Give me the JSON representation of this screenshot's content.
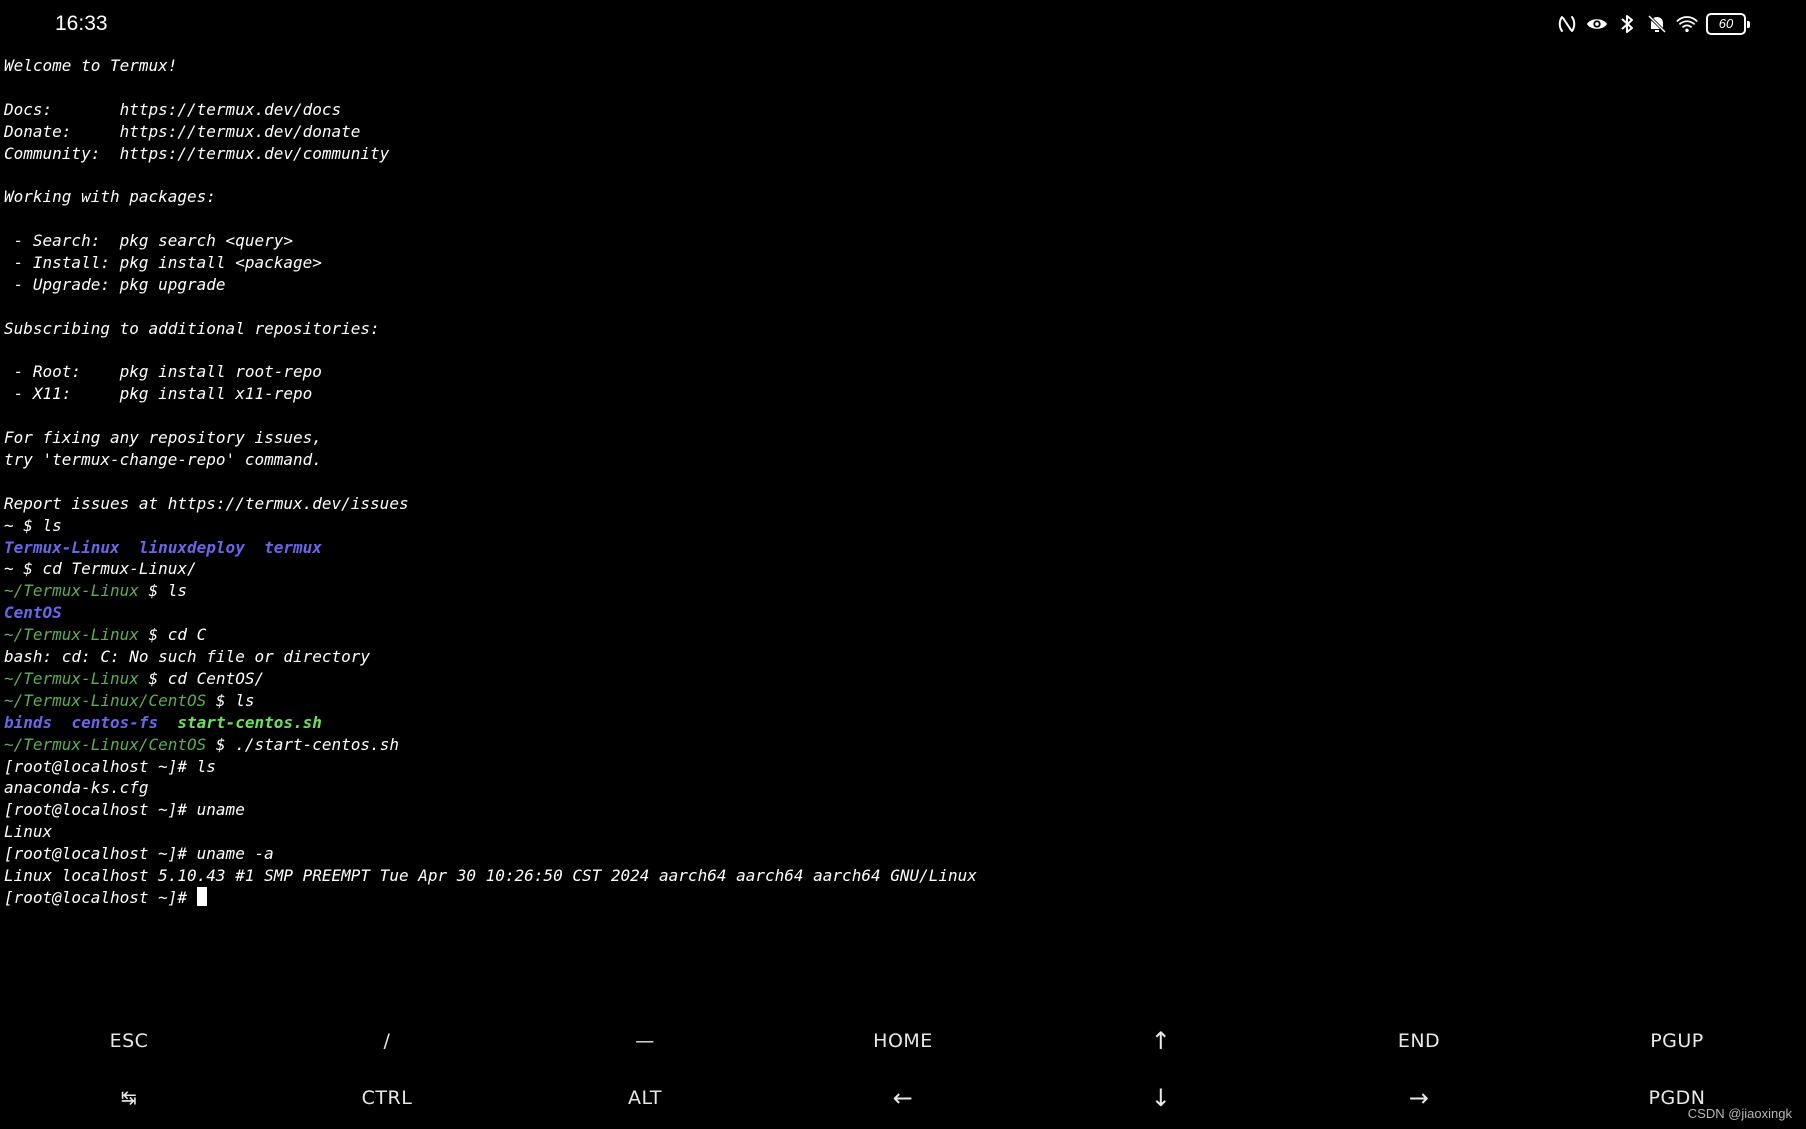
{
  "status_bar": {
    "time": "16:33",
    "battery_level": "60",
    "icons": [
      "nfc-icon",
      "eye-icon",
      "bluetooth-icon",
      "mute-bell-icon",
      "wifi-icon",
      "battery-icon"
    ]
  },
  "terminal": {
    "lines": [
      [
        {
          "t": "Welcome to Termux!"
        }
      ],
      [],
      [
        {
          "t": "Docs:       https://termux.dev/docs"
        }
      ],
      [
        {
          "t": "Donate:     https://termux.dev/donate"
        }
      ],
      [
        {
          "t": "Community:  https://termux.dev/community"
        }
      ],
      [],
      [
        {
          "t": "Working with packages:"
        }
      ],
      [],
      [
        {
          "t": " - Search:  pkg search <query>"
        }
      ],
      [
        {
          "t": " - Install: pkg install <package>"
        }
      ],
      [
        {
          "t": " - Upgrade: pkg upgrade"
        }
      ],
      [],
      [
        {
          "t": "Subscribing to additional repositories:"
        }
      ],
      [],
      [
        {
          "t": " - Root:    pkg install root-repo"
        }
      ],
      [
        {
          "t": " - X11:     pkg install x11-repo"
        }
      ],
      [],
      [
        {
          "t": "For fixing any repository issues,"
        }
      ],
      [
        {
          "t": "try 'termux-change-repo' command."
        }
      ],
      [],
      [
        {
          "t": "Report issues at https://termux.dev/issues"
        }
      ],
      [
        {
          "t": "~ $ ls"
        }
      ],
      [
        {
          "t": "Termux-Linux",
          "c": "blue"
        },
        {
          "t": "  "
        },
        {
          "t": "linuxdeploy",
          "c": "blue"
        },
        {
          "t": "  "
        },
        {
          "t": "termux",
          "c": "blue"
        }
      ],
      [
        {
          "t": "~ $ cd Termux-Linux/"
        }
      ],
      [
        {
          "t": "~/Termux-Linux",
          "c": "green"
        },
        {
          "t": " $ ls"
        }
      ],
      [
        {
          "t": "CentOS",
          "c": "blue"
        }
      ],
      [
        {
          "t": "~/Termux-Linux",
          "c": "green"
        },
        {
          "t": " $ cd C"
        }
      ],
      [
        {
          "t": "bash: cd: C: No such file or directory"
        }
      ],
      [
        {
          "t": "~/Termux-Linux",
          "c": "green"
        },
        {
          "t": " $ cd CentOS/"
        }
      ],
      [
        {
          "t": "~/Termux-Linux/CentOS",
          "c": "green"
        },
        {
          "t": " $ ls"
        }
      ],
      [
        {
          "t": "binds",
          "c": "blue"
        },
        {
          "t": "  "
        },
        {
          "t": "centos-fs",
          "c": "blue"
        },
        {
          "t": "  "
        },
        {
          "t": "start-centos.sh",
          "c": "bgreen"
        }
      ],
      [
        {
          "t": "~/Termux-Linux/CentOS",
          "c": "green"
        },
        {
          "t": " $ ./start-centos.sh"
        }
      ],
      [
        {
          "t": "[root@localhost ~]# ls"
        }
      ],
      [
        {
          "t": "anaconda-ks.cfg"
        }
      ],
      [
        {
          "t": "[root@localhost ~]# uname"
        }
      ],
      [
        {
          "t": "Linux"
        }
      ],
      [
        {
          "t": "[root@localhost ~]# uname -a"
        }
      ],
      [
        {
          "t": "Linux localhost 5.10.43 #1 SMP PREEMPT Tue Apr 30 10:26:50 CST 2024 aarch64 aarch64 aarch64 GNU/Linux"
        }
      ],
      [
        {
          "t": "[root@localhost ~]# "
        },
        {
          "cursor": true
        }
      ]
    ]
  },
  "extra_keys": {
    "row1": [
      {
        "label": "ESC",
        "name": "key-esc"
      },
      {
        "label": "/",
        "name": "key-slash"
      },
      {
        "label": "—",
        "name": "key-dash"
      },
      {
        "label": "HOME",
        "name": "key-home"
      },
      {
        "label": "↑",
        "name": "key-up-arrow"
      },
      {
        "label": "END",
        "name": "key-end"
      },
      {
        "label": "PGUP",
        "name": "key-pgup"
      }
    ],
    "row2": [
      {
        "label": "↹",
        "name": "key-tab"
      },
      {
        "label": "CTRL",
        "name": "key-ctrl"
      },
      {
        "label": "ALT",
        "name": "key-alt"
      },
      {
        "label": "←",
        "name": "key-left-arrow"
      },
      {
        "label": "↓",
        "name": "key-down-arrow"
      },
      {
        "label": "→",
        "name": "key-right-arrow"
      },
      {
        "label": "PGDN",
        "name": "key-pgdn"
      }
    ]
  },
  "watermark": "CSDN @jiaoxingk"
}
